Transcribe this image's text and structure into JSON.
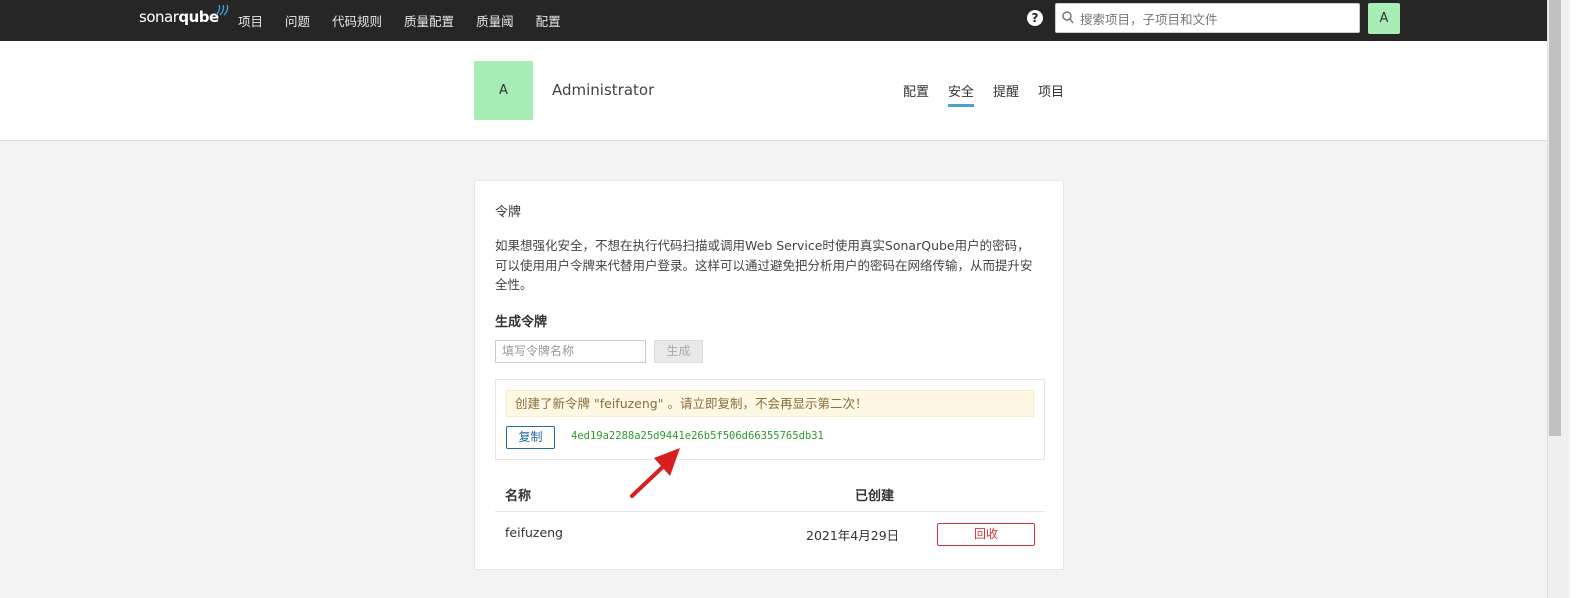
{
  "topbar": {
    "logo_a": "sonar",
    "logo_b": "qube",
    "nav": [
      "项目",
      "问题",
      "代码规则",
      "质量配置",
      "质量阈",
      "配置"
    ],
    "help": "?",
    "search_placeholder": "搜索项目，子项目和文件",
    "avatar": "A"
  },
  "header": {
    "avatar": "A",
    "name": "Administrator",
    "tabs": [
      "配置",
      "安全",
      "提醒",
      "项目"
    ],
    "active_tab": "安全"
  },
  "card": {
    "title": "令牌",
    "description": "如果想强化安全，不想在执行代码扫描或调用Web Service时使用真实SonarQube用户的密码，可以使用用户令牌来代替用户登录。这样可以通过避免把分析用户的密码在网络传输，从而提升安全性。",
    "generate_title": "生成令牌",
    "input_placeholder": "填写令牌名称",
    "generate_button": "生成",
    "alert": "创建了新令牌 \"feifuzeng\" 。请立即复制，不会再显示第二次！",
    "copy_button": "复制",
    "token_value": "4ed19a2288a25d9441e26b5f506d66355765db31",
    "table": {
      "col_name": "名称",
      "col_created": "已创建",
      "rows": [
        {
          "name": "feifuzeng",
          "created": "2021年4月29日",
          "action": "回收"
        }
      ]
    }
  },
  "colors": {
    "topbar": "#262626",
    "avatar": "#a7edb6",
    "tab_active": "#4b9fd5",
    "token_green": "#2c9a2c",
    "revoke_red": "#d4333f",
    "arrow_red": "#d81e1e"
  }
}
